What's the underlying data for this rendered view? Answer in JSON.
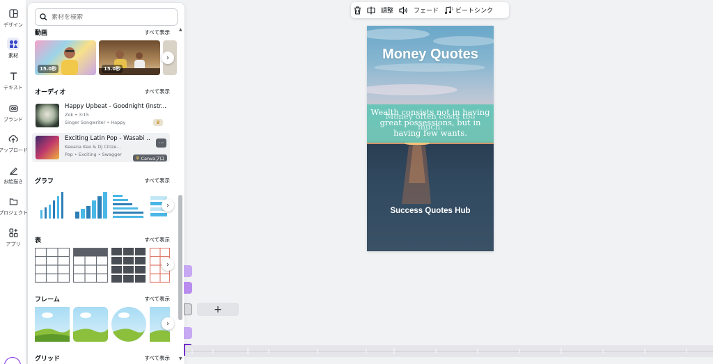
{
  "sidebar": {
    "items": [
      {
        "label": "デザイン",
        "icon": "layout-icon"
      },
      {
        "label": "素材",
        "icon": "elements-icon"
      },
      {
        "label": "テキスト",
        "icon": "text-icon"
      },
      {
        "label": "ブランド",
        "icon": "brand-icon"
      },
      {
        "label": "アップロード",
        "icon": "upload-icon"
      },
      {
        "label": "お絵描き",
        "icon": "draw-icon"
      },
      {
        "label": "プロジェクト",
        "icon": "folder-icon"
      },
      {
        "label": "アプリ",
        "icon": "apps-icon"
      }
    ]
  },
  "panel": {
    "search_placeholder": "素材を検索",
    "see_all": "すべて表示",
    "videos": {
      "title": "動画",
      "durations": [
        "15.0秒",
        "15.0秒"
      ]
    },
    "audio": {
      "title": "オーディオ",
      "tracks": [
        {
          "title": "Happy Upbeat - Goodnight (instr...",
          "meta1": "Zok • 3:15",
          "meta2": "Singer Songwriter • Happy"
        },
        {
          "title": "Exciting Latin Pop - Wasabi ...",
          "meta1": "Keeana Kee & DJ Citize...",
          "meta2": "Pop • Exciting • Swagger",
          "badge": "Canvaプロ"
        }
      ]
    },
    "graphs": {
      "title": "グラフ"
    },
    "tables": {
      "title": "表"
    },
    "frames": {
      "title": "フレーム"
    },
    "grids": {
      "title": "グリッド"
    }
  },
  "toolbar": {
    "adjust": "調整",
    "fade": "フェード",
    "beat_sync": "ビートシンク"
  },
  "canvas": {
    "title": "Money Quotes",
    "quote_a": "Wealth consists not in having great possessions, but in having few wants.",
    "quote_b": "Money often costs too much.",
    "brand": "Success Quotes Hub"
  },
  "timeline": {
    "add_label": "+"
  },
  "colors": {
    "accent": "#7d2ae8",
    "clip_purple": "#b98cf0",
    "band_teal": "#59c4b4"
  }
}
